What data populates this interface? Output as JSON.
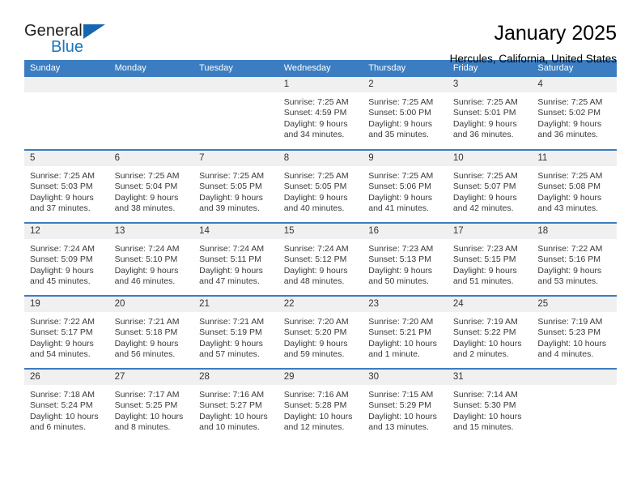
{
  "brand": {
    "name_part1": "General",
    "name_part2": "Blue",
    "accent_color": "#1b75bc",
    "triangle_color": "#1567b2"
  },
  "header": {
    "title": "January 2025",
    "location": "Hercules, California, United States"
  },
  "calendar": {
    "header_bg": "#3b7dc0",
    "daynum_bg": "#f0f0f0",
    "weekdays": [
      "Sunday",
      "Monday",
      "Tuesday",
      "Wednesday",
      "Thursday",
      "Friday",
      "Saturday"
    ],
    "weeks": [
      [
        {
          "day": "",
          "sunrise": "",
          "sunset": "",
          "daylight1": "",
          "daylight2": ""
        },
        {
          "day": "",
          "sunrise": "",
          "sunset": "",
          "daylight1": "",
          "daylight2": ""
        },
        {
          "day": "",
          "sunrise": "",
          "sunset": "",
          "daylight1": "",
          "daylight2": ""
        },
        {
          "day": "1",
          "sunrise": "Sunrise: 7:25 AM",
          "sunset": "Sunset: 4:59 PM",
          "daylight1": "Daylight: 9 hours",
          "daylight2": "and 34 minutes."
        },
        {
          "day": "2",
          "sunrise": "Sunrise: 7:25 AM",
          "sunset": "Sunset: 5:00 PM",
          "daylight1": "Daylight: 9 hours",
          "daylight2": "and 35 minutes."
        },
        {
          "day": "3",
          "sunrise": "Sunrise: 7:25 AM",
          "sunset": "Sunset: 5:01 PM",
          "daylight1": "Daylight: 9 hours",
          "daylight2": "and 36 minutes."
        },
        {
          "day": "4",
          "sunrise": "Sunrise: 7:25 AM",
          "sunset": "Sunset: 5:02 PM",
          "daylight1": "Daylight: 9 hours",
          "daylight2": "and 36 minutes."
        }
      ],
      [
        {
          "day": "5",
          "sunrise": "Sunrise: 7:25 AM",
          "sunset": "Sunset: 5:03 PM",
          "daylight1": "Daylight: 9 hours",
          "daylight2": "and 37 minutes."
        },
        {
          "day": "6",
          "sunrise": "Sunrise: 7:25 AM",
          "sunset": "Sunset: 5:04 PM",
          "daylight1": "Daylight: 9 hours",
          "daylight2": "and 38 minutes."
        },
        {
          "day": "7",
          "sunrise": "Sunrise: 7:25 AM",
          "sunset": "Sunset: 5:05 PM",
          "daylight1": "Daylight: 9 hours",
          "daylight2": "and 39 minutes."
        },
        {
          "day": "8",
          "sunrise": "Sunrise: 7:25 AM",
          "sunset": "Sunset: 5:05 PM",
          "daylight1": "Daylight: 9 hours",
          "daylight2": "and 40 minutes."
        },
        {
          "day": "9",
          "sunrise": "Sunrise: 7:25 AM",
          "sunset": "Sunset: 5:06 PM",
          "daylight1": "Daylight: 9 hours",
          "daylight2": "and 41 minutes."
        },
        {
          "day": "10",
          "sunrise": "Sunrise: 7:25 AM",
          "sunset": "Sunset: 5:07 PM",
          "daylight1": "Daylight: 9 hours",
          "daylight2": "and 42 minutes."
        },
        {
          "day": "11",
          "sunrise": "Sunrise: 7:25 AM",
          "sunset": "Sunset: 5:08 PM",
          "daylight1": "Daylight: 9 hours",
          "daylight2": "and 43 minutes."
        }
      ],
      [
        {
          "day": "12",
          "sunrise": "Sunrise: 7:24 AM",
          "sunset": "Sunset: 5:09 PM",
          "daylight1": "Daylight: 9 hours",
          "daylight2": "and 45 minutes."
        },
        {
          "day": "13",
          "sunrise": "Sunrise: 7:24 AM",
          "sunset": "Sunset: 5:10 PM",
          "daylight1": "Daylight: 9 hours",
          "daylight2": "and 46 minutes."
        },
        {
          "day": "14",
          "sunrise": "Sunrise: 7:24 AM",
          "sunset": "Sunset: 5:11 PM",
          "daylight1": "Daylight: 9 hours",
          "daylight2": "and 47 minutes."
        },
        {
          "day": "15",
          "sunrise": "Sunrise: 7:24 AM",
          "sunset": "Sunset: 5:12 PM",
          "daylight1": "Daylight: 9 hours",
          "daylight2": "and 48 minutes."
        },
        {
          "day": "16",
          "sunrise": "Sunrise: 7:23 AM",
          "sunset": "Sunset: 5:13 PM",
          "daylight1": "Daylight: 9 hours",
          "daylight2": "and 50 minutes."
        },
        {
          "day": "17",
          "sunrise": "Sunrise: 7:23 AM",
          "sunset": "Sunset: 5:15 PM",
          "daylight1": "Daylight: 9 hours",
          "daylight2": "and 51 minutes."
        },
        {
          "day": "18",
          "sunrise": "Sunrise: 7:22 AM",
          "sunset": "Sunset: 5:16 PM",
          "daylight1": "Daylight: 9 hours",
          "daylight2": "and 53 minutes."
        }
      ],
      [
        {
          "day": "19",
          "sunrise": "Sunrise: 7:22 AM",
          "sunset": "Sunset: 5:17 PM",
          "daylight1": "Daylight: 9 hours",
          "daylight2": "and 54 minutes."
        },
        {
          "day": "20",
          "sunrise": "Sunrise: 7:21 AM",
          "sunset": "Sunset: 5:18 PM",
          "daylight1": "Daylight: 9 hours",
          "daylight2": "and 56 minutes."
        },
        {
          "day": "21",
          "sunrise": "Sunrise: 7:21 AM",
          "sunset": "Sunset: 5:19 PM",
          "daylight1": "Daylight: 9 hours",
          "daylight2": "and 57 minutes."
        },
        {
          "day": "22",
          "sunrise": "Sunrise: 7:20 AM",
          "sunset": "Sunset: 5:20 PM",
          "daylight1": "Daylight: 9 hours",
          "daylight2": "and 59 minutes."
        },
        {
          "day": "23",
          "sunrise": "Sunrise: 7:20 AM",
          "sunset": "Sunset: 5:21 PM",
          "daylight1": "Daylight: 10 hours",
          "daylight2": "and 1 minute."
        },
        {
          "day": "24",
          "sunrise": "Sunrise: 7:19 AM",
          "sunset": "Sunset: 5:22 PM",
          "daylight1": "Daylight: 10 hours",
          "daylight2": "and 2 minutes."
        },
        {
          "day": "25",
          "sunrise": "Sunrise: 7:19 AM",
          "sunset": "Sunset: 5:23 PM",
          "daylight1": "Daylight: 10 hours",
          "daylight2": "and 4 minutes."
        }
      ],
      [
        {
          "day": "26",
          "sunrise": "Sunrise: 7:18 AM",
          "sunset": "Sunset: 5:24 PM",
          "daylight1": "Daylight: 10 hours",
          "daylight2": "and 6 minutes."
        },
        {
          "day": "27",
          "sunrise": "Sunrise: 7:17 AM",
          "sunset": "Sunset: 5:25 PM",
          "daylight1": "Daylight: 10 hours",
          "daylight2": "and 8 minutes."
        },
        {
          "day": "28",
          "sunrise": "Sunrise: 7:16 AM",
          "sunset": "Sunset: 5:27 PM",
          "daylight1": "Daylight: 10 hours",
          "daylight2": "and 10 minutes."
        },
        {
          "day": "29",
          "sunrise": "Sunrise: 7:16 AM",
          "sunset": "Sunset: 5:28 PM",
          "daylight1": "Daylight: 10 hours",
          "daylight2": "and 12 minutes."
        },
        {
          "day": "30",
          "sunrise": "Sunrise: 7:15 AM",
          "sunset": "Sunset: 5:29 PM",
          "daylight1": "Daylight: 10 hours",
          "daylight2": "and 13 minutes."
        },
        {
          "day": "31",
          "sunrise": "Sunrise: 7:14 AM",
          "sunset": "Sunset: 5:30 PM",
          "daylight1": "Daylight: 10 hours",
          "daylight2": "and 15 minutes."
        },
        {
          "day": "",
          "sunrise": "",
          "sunset": "",
          "daylight1": "",
          "daylight2": ""
        }
      ]
    ]
  }
}
